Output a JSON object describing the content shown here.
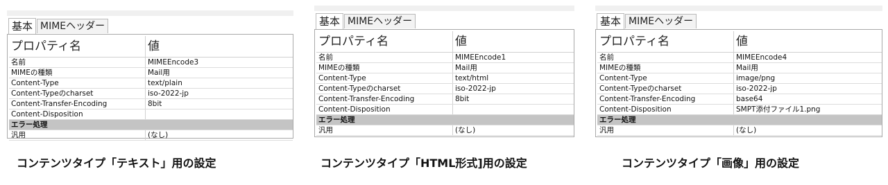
{
  "tabs": {
    "basic": "基本",
    "mime": "MIMEヘッダー"
  },
  "headers": {
    "property": "プロパティ名",
    "value": "値"
  },
  "labels": {
    "name": "名前",
    "mime_type": "MIMEの種類",
    "content_type": "Content-Type",
    "charset": "Content-Typeのcharset",
    "encoding": "Content-Transfer-Encoding",
    "disposition": "Content-Disposition",
    "error_section": "エラー処理",
    "general": "汎用"
  },
  "panels": [
    {
      "values": {
        "name": "MIMEEncode3",
        "mime_type": "Mail用",
        "content_type": "text/plain",
        "charset": "iso-2022-jp",
        "encoding": "8bit",
        "disposition": "",
        "general": "(なし)"
      },
      "caption": "コンテンツタイプ「テキスト」用の設定"
    },
    {
      "values": {
        "name": "MIMEEncode1",
        "mime_type": "Mail用",
        "content_type": "text/html",
        "charset": "iso-2022-jp",
        "encoding": "8bit",
        "disposition": "",
        "general": "(なし)"
      },
      "caption": "コンテンツタイプ「HTML形式]用の設定"
    },
    {
      "values": {
        "name": "MIMEEncode4",
        "mime_type": "Mail用",
        "content_type": "image/png",
        "charset": "iso-2022-jp",
        "encoding": "base64",
        "disposition": "SMPT添付ファイル1.png",
        "general": "(なし)"
      },
      "caption": "コンテンツタイプ「画像」用の設定"
    }
  ]
}
